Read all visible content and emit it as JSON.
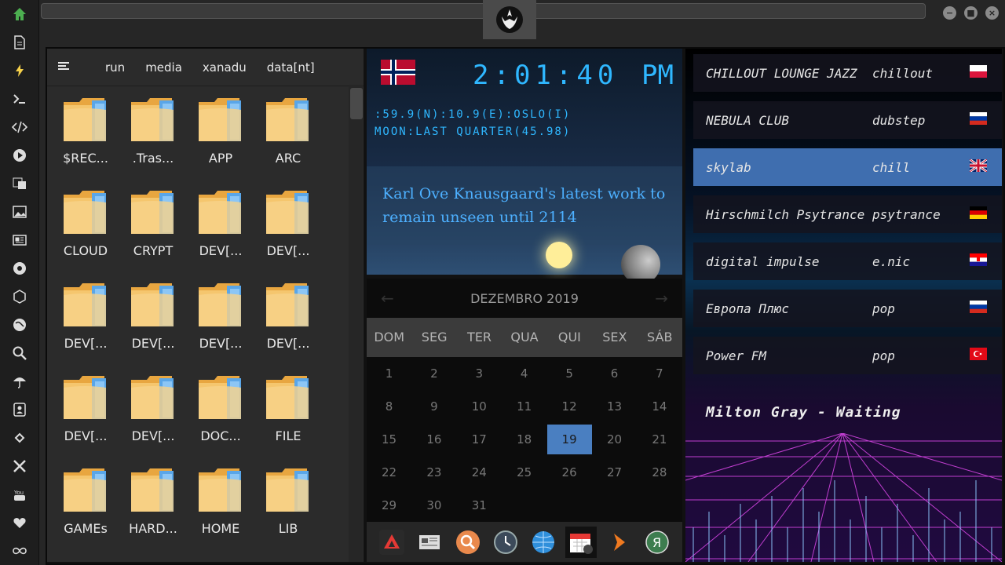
{
  "topbar": {
    "logo_icon": "rebel-alliance-icon",
    "window_buttons": [
      "−",
      "■",
      "×"
    ]
  },
  "sidebar": {
    "icons": [
      "home-icon",
      "document-icon",
      "lightning-icon",
      "terminal-icon",
      "code-icon",
      "play-icon",
      "translate-icon",
      "image-icon",
      "newspaper-icon",
      "settings-wheel-icon",
      "hexagon-icon",
      "globe-icon",
      "search-icon",
      "umbrella-icon",
      "contacts-icon",
      "link-icon",
      "expand-icon",
      "youtube-icon",
      "heart-icon",
      "infinity-icon"
    ]
  },
  "file_manager": {
    "tabs": [
      "run",
      "media",
      "xanadu",
      "data[nt]"
    ],
    "items": [
      "$REC...",
      ".Tras...",
      "APP",
      "ARC",
      "CLOUD",
      "CRYPT",
      "DEV[...",
      "DEV[...",
      "DEV[...",
      "DEV[...",
      "DEV[...",
      "DEV[...",
      "DEV[...",
      "DEV[...",
      "DOC...",
      "FILE",
      "GAMEs",
      "HARD...",
      "HOME",
      "LIB"
    ]
  },
  "clock": {
    "time": "2:01:40",
    "ampm": "PM",
    "location": ":59.9(N):10.9(E):OSLO(I)",
    "moon": "MOON:LAST QUARTER(45.98)",
    "headline": "Karl Ove Knausgaard's latest work to remain unseen until 2114"
  },
  "calendar": {
    "month_label": "DEZEMBRO 2019",
    "prev": "←",
    "next": "→",
    "dows": [
      "DOM",
      "SEG",
      "TER",
      "QUA",
      "QUI",
      "SEX",
      "SÁB"
    ],
    "days": [
      "1",
      "2",
      "3",
      "4",
      "5",
      "6",
      "7",
      "8",
      "9",
      "10",
      "11",
      "12",
      "13",
      "14",
      "15",
      "16",
      "17",
      "18",
      "19",
      "20",
      "21",
      "22",
      "23",
      "24",
      "25",
      "26",
      "27",
      "28",
      "29",
      "30",
      "31"
    ],
    "today": "19"
  },
  "dock": {
    "apps": [
      "app-launcher-icon",
      "news-icon",
      "search-icon",
      "clock-icon",
      "browser-icon",
      "calendar-icon",
      "arrow-icon",
      "yandex-icon"
    ]
  },
  "radio": {
    "stations": [
      {
        "name": "CHILLOUT LOUNGE JAZZ",
        "genre": "chillout",
        "flag": "poland-flag-icon"
      },
      {
        "name": "NEBULA CLUB",
        "genre": "dubstep",
        "flag": "russia-flag-icon"
      },
      {
        "name": "skylab",
        "genre": "chill",
        "flag": "uk-flag-icon"
      },
      {
        "name": "Hirschmilch Psytrance",
        "genre": "psytrance",
        "flag": "germany-flag-icon"
      },
      {
        "name": "digital impulse",
        "genre": "e.nic",
        "flag": "croatia-flag-icon"
      },
      {
        "name": "Европа Плюс",
        "genre": "pop",
        "flag": "russia-flag-icon"
      },
      {
        "name": "Power FM",
        "genre": "pop",
        "flag": "turkey-flag-icon"
      }
    ],
    "now_playing": "Milton Gray - Waiting"
  }
}
